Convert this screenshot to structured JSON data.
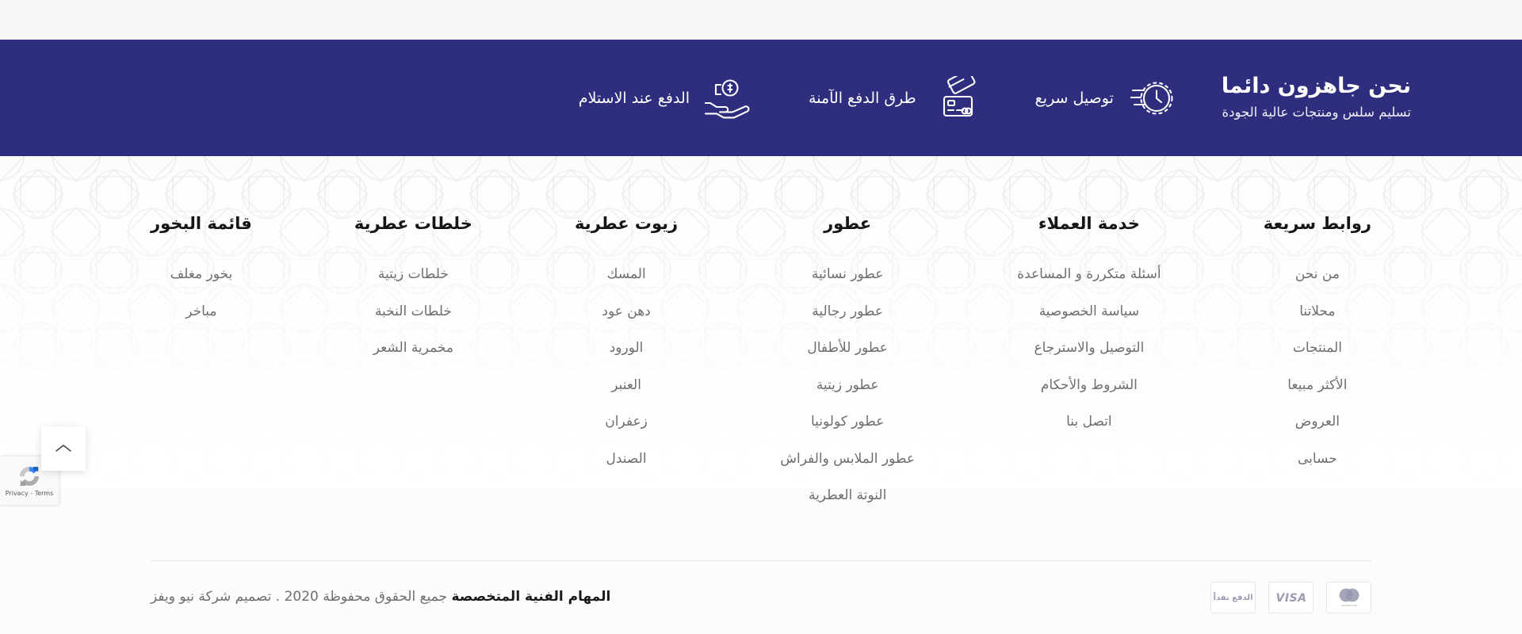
{
  "feature_band": {
    "brand_title": "نحن جاهزون دائما",
    "brand_subtitle": "تسليم سلس ومنتجات عالية الجودة",
    "background_color": "#2e2d7e",
    "features": [
      {
        "label": "توصيل سريع",
        "icon": "fast-clock-icon"
      },
      {
        "label": "طرق الدفع الآمنة",
        "icon": "credit-cards-icon"
      },
      {
        "label": "الدفع عند الاستلام",
        "icon": "hand-coin-icon"
      }
    ]
  },
  "columns": [
    {
      "title": "روابط سريعة",
      "key": "quick-links",
      "links": [
        "من نحن",
        "محلاتنا",
        "المنتجات",
        "الأكثر مبيعا",
        "العروض",
        "حسابى"
      ]
    },
    {
      "title": "خدمة العملاء",
      "key": "customer-service",
      "links": [
        "أسئلة متكررة و المساعدة",
        "سياسة الخصوصية",
        "التوصيل والاسترجاع",
        "الشروط والأحكام",
        "اتصل بنا"
      ]
    },
    {
      "title": "عطور",
      "key": "perfumes",
      "links": [
        "عطور نسائية",
        "عطور رجالية",
        "عطور للأطفال",
        "عطور زيتية",
        "عطور كولونيا",
        "عطور الملابس والفراش",
        "النوتة العطرية"
      ]
    },
    {
      "title": "زيوت عطرية",
      "key": "aromatic-oils",
      "links": [
        "المسك",
        "دهن عود",
        "الورود",
        "العنبر",
        "زعفران",
        "الصندل"
      ]
    },
    {
      "title": "خلطات عطرية",
      "key": "aromatic-blends",
      "links": [
        "خلطات زيتية",
        "خلطات النخبة",
        "مخمرية الشعر"
      ]
    },
    {
      "title": "قائمة البخور",
      "key": "incense-menu",
      "links": [
        "بخور مغلف",
        "مباخر"
      ]
    }
  ],
  "bottom": {
    "copyright_brand": "المهام الفنية المتخصصة",
    "copyright_rest": " جميع الحقوق محفوظة 2020 . تصميم شركة نيو ويفز",
    "payment_methods": [
      {
        "name": "cash-on-delivery",
        "label": "الدفع نقداً"
      },
      {
        "name": "visa",
        "label": "VISA"
      },
      {
        "name": "mastercard",
        "label": "mastercard"
      }
    ]
  },
  "widgets": {
    "scroll_top_icon": "chevron-up-icon",
    "recaptcha_text": "Privacy - Terms"
  }
}
